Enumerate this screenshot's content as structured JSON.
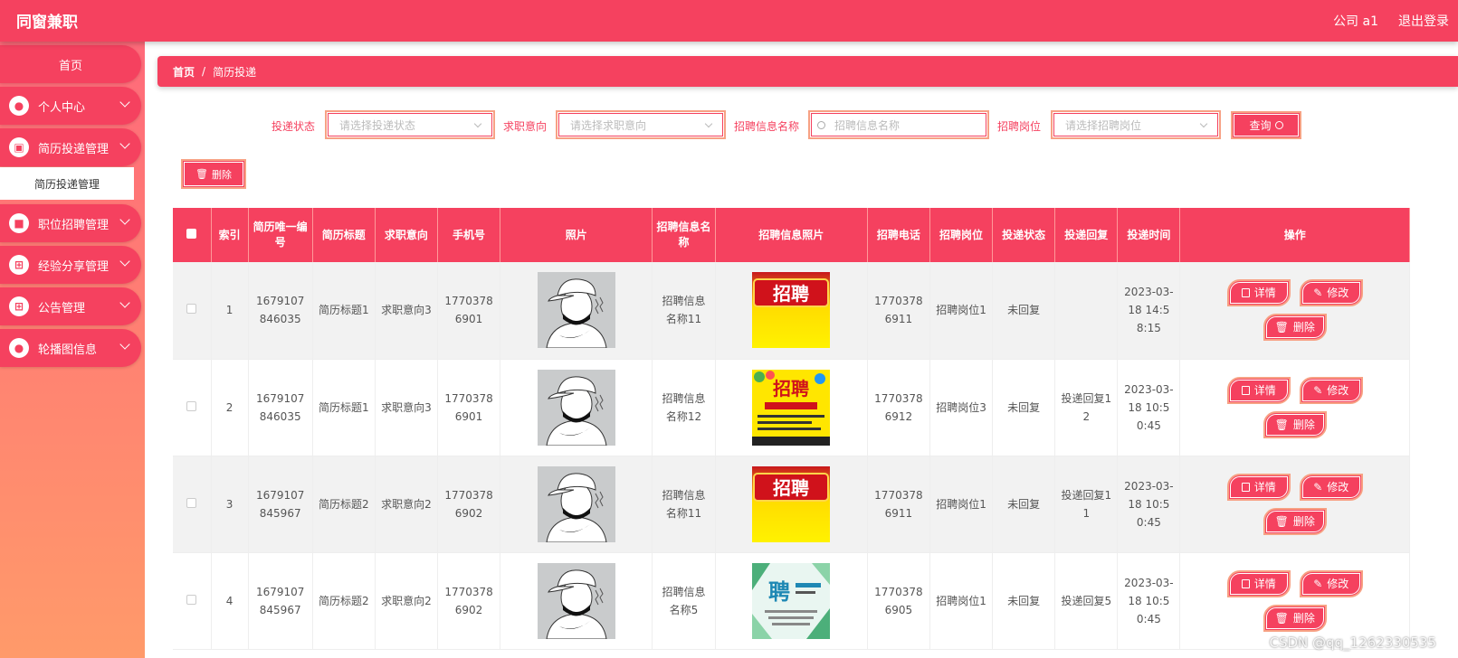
{
  "app": {
    "title": "同窗兼职"
  },
  "header": {
    "user": "公司 a1",
    "logout": "退出登录"
  },
  "sidebar": {
    "home": "首页",
    "items": [
      {
        "label": "个人中心",
        "icon": "person-icon"
      },
      {
        "label": "简历投递管理",
        "icon": "clipboard-icon"
      },
      {
        "label": "职位招聘管理",
        "icon": "ticket-icon"
      },
      {
        "label": "经验分享管理",
        "icon": "grid-icon"
      },
      {
        "label": "公告管理",
        "icon": "grid-icon"
      },
      {
        "label": "轮播图信息",
        "icon": "person-icon"
      }
    ],
    "active_sub": "简历投递管理"
  },
  "breadcrumb": {
    "home": "首页",
    "sep": "/",
    "current": "简历投递"
  },
  "filters": {
    "status_label": "投递状态",
    "status_placeholder": "请选择投递状态",
    "intent_label": "求职意向",
    "intent_placeholder": "请选择求职意向",
    "info_label": "招聘信息名称",
    "info_placeholder": "招聘信息名称",
    "position_label": "招聘岗位",
    "position_placeholder": "请选择招聘岗位",
    "query": "查询"
  },
  "toolbar": {
    "delete": "删除"
  },
  "table": {
    "headers": [
      "索引",
      "简历唯一编号",
      "简历标题",
      "求职意向",
      "手机号",
      "照片",
      "招聘信息名称",
      "招聘信息照片",
      "招聘电话",
      "招聘岗位",
      "投递状态",
      "投递回复",
      "投递时间",
      "操作"
    ],
    "rows": [
      {
        "index": "1",
        "resume_no": "1679107846035",
        "title": "简历标题1",
        "intent": "求职意向3",
        "phone": "17703786901",
        "info_name": "招聘信息名称11",
        "info_img": "poster-a",
        "rec_phone": "17703786911",
        "position": "招聘岗位1",
        "status": "未回复",
        "reply": "",
        "time": "2023-03-18 14:58:15"
      },
      {
        "index": "2",
        "resume_no": "1679107846035",
        "title": "简历标题1",
        "intent": "求职意向3",
        "phone": "17703786901",
        "info_name": "招聘信息名称12",
        "info_img": "poster-b",
        "rec_phone": "17703786912",
        "position": "招聘岗位3",
        "status": "未回复",
        "reply": "投递回复12",
        "time": "2023-03-18 10:50:45"
      },
      {
        "index": "3",
        "resume_no": "1679107845967",
        "title": "简历标题2",
        "intent": "求职意向2",
        "phone": "17703786902",
        "info_name": "招聘信息名称11",
        "info_img": "poster-a",
        "rec_phone": "17703786911",
        "position": "招聘岗位1",
        "status": "未回复",
        "reply": "投递回复11",
        "time": "2023-03-18 10:50:45"
      },
      {
        "index": "4",
        "resume_no": "1679107845967",
        "title": "简历标题2",
        "intent": "求职意向2",
        "phone": "17703786902",
        "info_name": "招聘信息名称5",
        "info_img": "poster-c",
        "rec_phone": "17703786905",
        "position": "招聘岗位1",
        "status": "未回复",
        "reply": "投递回复5",
        "time": "2023-03-18 10:50:45"
      }
    ],
    "ops": {
      "detail": "详情",
      "edit": "修改",
      "delete": "删除"
    }
  },
  "poster_text": {
    "a": "招聘",
    "b": "招聘",
    "c": "聘"
  },
  "watermark": "CSDN @qq_1262330535",
  "colors": {
    "primary": "#f5415f",
    "border": "#f7a184",
    "sidebar_top": "#ff6a7a",
    "sidebar_bottom": "#ff9a6a"
  }
}
